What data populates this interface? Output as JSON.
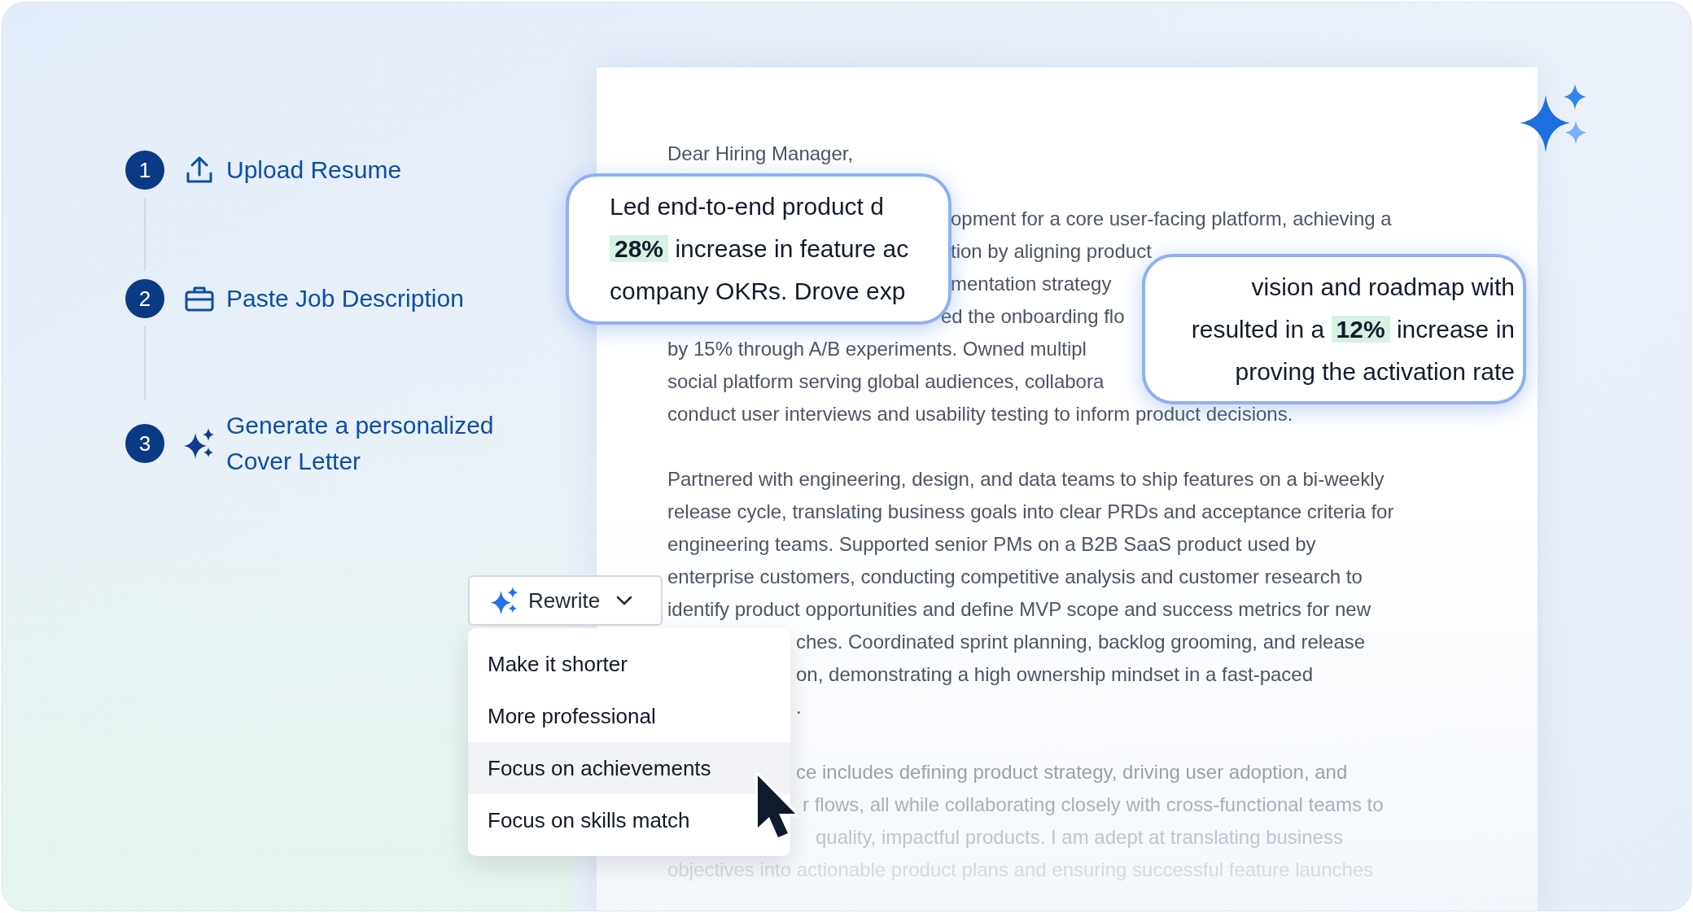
{
  "steps": [
    {
      "number": "1",
      "label": "Upload Resume",
      "kind": "upload"
    },
    {
      "number": "2",
      "label": "Paste Job Description",
      "kind": "briefcase"
    },
    {
      "number": "3",
      "label": "Generate a personalized Cover Letter",
      "kind": "sparkles"
    }
  ],
  "document": {
    "greeting": "Dear Hiring Manager,",
    "paragraphs": [
      {
        "faded": false,
        "lines": [
          {
            "text": "opment for a core user-facing platform, achieving a",
            "kind": "after_callout"
          },
          {
            "text": "tion by aligning product",
            "kind": "after_callout"
          },
          {
            "text": "mentation strategy",
            "kind": "after_callout"
          },
          {
            "text": "ed the onboarding flo",
            "kind": "after_callout_curve"
          },
          {
            "text": "by 15% through A/B experiments. Owned multipl",
            "kind": "full"
          },
          {
            "text": "social platform serving global audiences, collabora",
            "kind": "full"
          },
          {
            "text": "conduct user interviews and usability testing to inform product decisions.",
            "kind": "full"
          }
        ]
      },
      {
        "faded": false,
        "lines": [
          {
            "text": "Partnered with engineering, design, and data teams to ship features on a bi-weekly",
            "kind": "full"
          },
          {
            "text": "release cycle, translating business goals into clear PRDs and acceptance criteria for",
            "kind": "full"
          },
          {
            "text": "engineering teams. Supported senior PMs on a B2B SaaS product used by",
            "kind": "full"
          },
          {
            "text": "enterprise customers, conducting competitive analysis and customer research to",
            "kind": "full"
          },
          {
            "text": "identify product opportunities and define MVP scope and success metrics for new",
            "kind": "full"
          },
          {
            "text": "ches. Coordinated sprint planning, backlog grooming, and release",
            "kind": "after_menu"
          },
          {
            "text": "on, demonstrating a high ownership mindset in a fast-paced",
            "kind": "after_menu"
          },
          {
            "text": ".",
            "kind": "after_menu"
          }
        ]
      },
      {
        "faded": true,
        "lines": [
          {
            "text": "ce includes defining product strategy, driving user adoption, and",
            "kind": "after_menu"
          },
          {
            "text": "r flows, all while collaborating closely with cross-functional teams to",
            "kind": "after_cursor"
          },
          {
            "text": "quality, impactful products. I am adept at translating business",
            "kind": "after_cursor_low"
          },
          {
            "text": "objectives into actionable product plans and ensuring successful feature launches",
            "kind": "full"
          }
        ]
      }
    ]
  },
  "callouts": [
    {
      "lines": [
        "Led end-to-end product d",
        "**28%** increase in feature ac",
        "company OKRs. Drove exp"
      ]
    },
    {
      "lines": [
        "vision and roadmap with",
        "resulted in a **12%** increase in",
        "proving the activation rate"
      ]
    }
  ],
  "rewrite_menu": {
    "button": "Rewrite",
    "items": [
      {
        "label": "Make it shorter",
        "selected": false
      },
      {
        "label": "More professional",
        "selected": false
      },
      {
        "label": "Focus on achievements",
        "selected": true
      },
      {
        "label": "Focus on skills match",
        "selected": false
      }
    ]
  }
}
